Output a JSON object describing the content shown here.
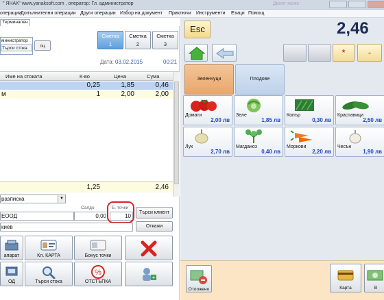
{
  "window": {
    "title": "\" ЯНАК\" www.yanaksoft.com , оператор: Гл. администратор",
    "ghost_title": "Двоят може"
  },
  "menu": [
    "операции",
    "Допълнителни операции",
    "Други операции",
    "Избор на документ",
    "Приключи",
    "Инструменти",
    "Езици",
    "Помощ"
  ],
  "tab": {
    "label": "Терминален"
  },
  "user": {
    "name": "министратор",
    "search_label": "Търси стока",
    "pts_button": "пц"
  },
  "bills": [
    {
      "label": "Сметка",
      "num": "1",
      "active": true
    },
    {
      "label": "Сметка",
      "num": "2",
      "active": false
    },
    {
      "label": "Сметка",
      "num": "3",
      "active": false
    }
  ],
  "date": {
    "label": "Дата:",
    "value": "03.02.2015",
    "time": "00:21"
  },
  "grid": {
    "headers": {
      "name": "Име на стоката",
      "qty": "К-во",
      "price": "Цена",
      "sum": "Сума"
    },
    "rows": [
      {
        "name": "",
        "qty": "0,25",
        "price": "1,85",
        "sum": "0,46",
        "selected": true
      },
      {
        "name": "м",
        "qty": "1",
        "price": "2,00",
        "sum": "2,00",
        "selected": false
      }
    ],
    "totals": {
      "qty": "1,25",
      "sum": "2,46"
    }
  },
  "doc_type": "разписка",
  "client": {
    "saldo_label": "Салдо",
    "points_label": "Б. точки",
    "name": "ЕООД",
    "saldo": "0,00",
    "points": "10",
    "find_button": "Търси клиент",
    "cancel_button": "Откажи",
    "operator": "киев"
  },
  "function_buttons": [
    {
      "label": "апарат",
      "icon": "cash-register-icon"
    },
    {
      "label": "Кл. КАРТА",
      "icon": "client-card-icon"
    },
    {
      "label": "Бонус точки",
      "icon": "bonus-card-icon"
    },
    {
      "label": "",
      "icon": "delete-x-icon"
    },
    {
      "label": "ОД",
      "icon": "barcode-icon"
    },
    {
      "label": "Търси стока",
      "icon": "magnifier-icon"
    },
    {
      "label": "ОТСТЪПКА",
      "icon": "percent-icon"
    },
    {
      "label": "",
      "icon": "add-user-icon"
    }
  ],
  "right": {
    "esc": "Esc",
    "total": "2,46",
    "op_buttons": [
      "*",
      "-"
    ],
    "categories": [
      "Зеленчуци",
      "Плодове"
    ],
    "products": [
      {
        "name": "Домати",
        "price": "2,00 лв",
        "icon": "tomato-icon"
      },
      {
        "name": "Зеле",
        "price": "1,85 лв",
        "icon": "cabbage-icon"
      },
      {
        "name": "Копър",
        "price": "0,30 лв",
        "icon": "dill-icon"
      },
      {
        "name": "Краставици",
        "price": "2,50 лв",
        "icon": "cucumber-icon"
      },
      {
        "name": "Лук",
        "price": "2,70 лв",
        "icon": "onion-icon"
      },
      {
        "name": "Магданоз",
        "price": "0,40 лв",
        "icon": "parsley-icon"
      },
      {
        "name": "Моркови",
        "price": "2,20 лв",
        "icon": "carrot-icon"
      },
      {
        "name": "Чесън",
        "price": "1,90 лв",
        "icon": "garlic-icon"
      }
    ],
    "held_button": "Отложено",
    "card_button": "Карта",
    "cash_button": "В"
  },
  "colors": {
    "accent_blue": "#2f5bb5",
    "price_blue": "#1a44c2",
    "active_category": "#e9a76b",
    "grid_selected": "#bcd4f1",
    "ring_red": "#e02020"
  }
}
